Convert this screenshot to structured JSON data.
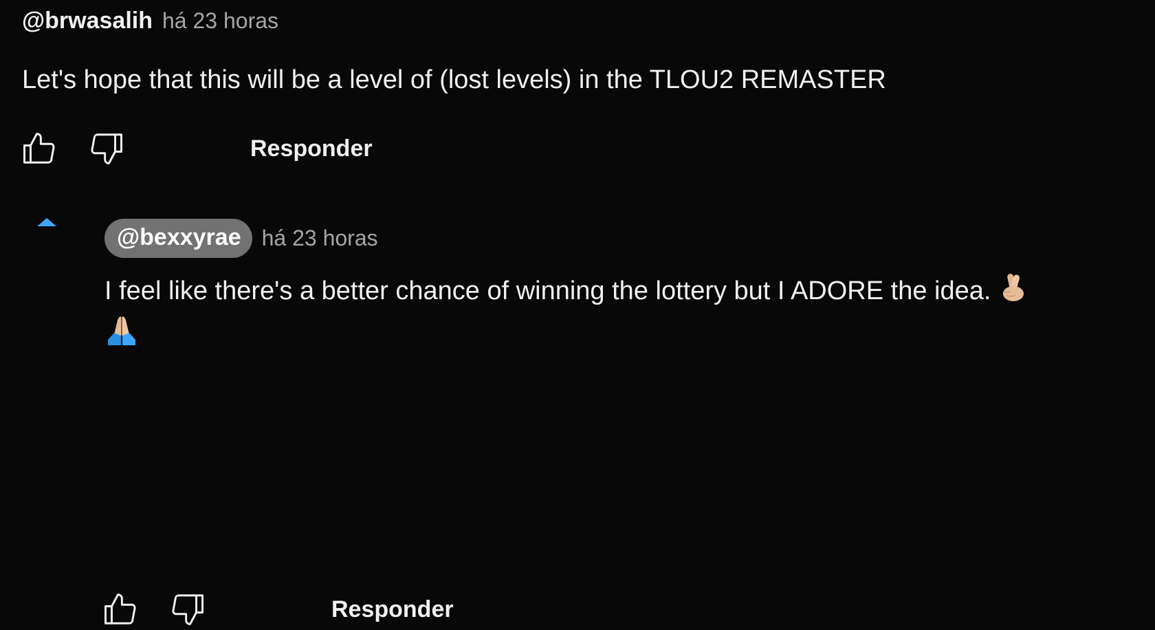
{
  "comments": [
    {
      "author": "@brwasalih",
      "time": "há 23 horas",
      "text": "Let's hope that this will be a level of (lost levels) in the TLOU2 REMASTER",
      "reply_label": "Responder"
    },
    {
      "author": "@bexxyrae",
      "time": "há 23 horas",
      "text": "I feel like there's a better chance of winning the lottery but I ADORE the idea.",
      "reply_label": "Responder",
      "emojis": [
        "crossed-fingers",
        "folded-hands"
      ]
    }
  ],
  "colors": {
    "background": "#080808",
    "text": "#f1f1f1",
    "muted": "#a6a6a6",
    "accent": "#3ea6ff",
    "pill": "#727272"
  },
  "icons": [
    "like-icon",
    "dislike-icon",
    "collapse-replies-icon"
  ]
}
